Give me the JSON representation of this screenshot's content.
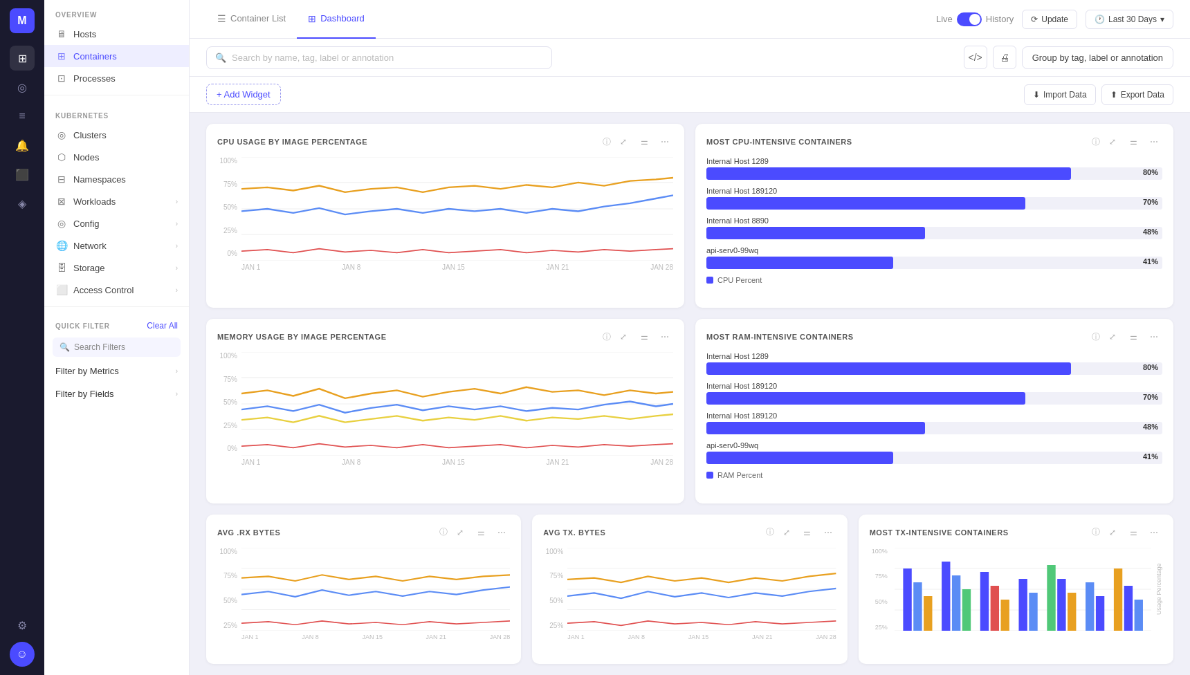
{
  "app": {
    "logo": "M",
    "logo_color": "#4b4bff"
  },
  "tabs": [
    {
      "id": "container-list",
      "label": "Container List",
      "icon": "☰",
      "active": false
    },
    {
      "id": "dashboard",
      "label": "Dashboard",
      "icon": "⊞",
      "active": true
    }
  ],
  "topbar": {
    "live_label": "Live",
    "history_label": "History",
    "update_label": "Update",
    "date_range": "Last 30 Days"
  },
  "toolbar": {
    "search_placeholder": "Search by name, tag, label or annotation",
    "group_by_label": "Group by tag, label or annotation",
    "code_icon": "</>",
    "printer_icon": "🖨"
  },
  "widget_toolbar": {
    "add_widget": "+ Add Widget",
    "import": "Import Data",
    "export": "Export Data"
  },
  "sidebar": {
    "overview_label": "OVERVIEW",
    "hosts_label": "Hosts",
    "containers_label": "Containers",
    "processes_label": "Processes",
    "kubernetes_label": "KUBERNETES",
    "clusters_label": "Clusters",
    "nodes_label": "Nodes",
    "namespaces_label": "Namespaces",
    "workloads_label": "Workloads",
    "config_label": "Config",
    "network_label": "Network",
    "storage_label": "Storage",
    "access_control_label": "Access Control",
    "quick_filter_label": "QUICK FILTER",
    "clear_all_label": "Clear All",
    "search_filters_placeholder": "Search Filters",
    "filter_metrics_label": "Filter by Metrics",
    "filter_fields_label": "Filter by Fields"
  },
  "cpu_chart": {
    "title": "CPU USAGE BY IMAGE PERCENTAGE",
    "y_labels": [
      "100%",
      "75%",
      "50%",
      "25%",
      "0%"
    ],
    "x_labels": [
      "JAN 1",
      "JAN 8",
      "JAN 15",
      "JAN 21",
      "JAN 28"
    ]
  },
  "cpu_intensive": {
    "title": "MOST CPU-INTENSIVE CONTAINERS",
    "bars": [
      {
        "label": "Internal Host 1289",
        "pct": 80
      },
      {
        "label": "Internal Host 189120",
        "pct": 70
      },
      {
        "label": "Internal Host 8890",
        "pct": 48
      },
      {
        "label": "api-serv0-99wq",
        "pct": 41
      }
    ],
    "legend": "CPU Percent"
  },
  "memory_chart": {
    "title": "MEMORY USAGE BY IMAGE PERCENTAGE",
    "y_labels": [
      "100%",
      "75%",
      "50%",
      "25%",
      "0%"
    ],
    "x_labels": [
      "JAN 1",
      "JAN 8",
      "JAN 15",
      "JAN 21",
      "JAN 28"
    ]
  },
  "ram_intensive": {
    "title": "MOST RAM-INTENSIVE CONTAINERS",
    "bars": [
      {
        "label": "Internal Host 1289",
        "pct": 80
      },
      {
        "label": "Internal Host 189120",
        "pct": 70
      },
      {
        "label": "Internal Host 189120",
        "pct": 48
      },
      {
        "label": "api-serv0-99wq",
        "pct": 41
      }
    ],
    "legend": "RAM Percent"
  },
  "rx_chart": {
    "title": "AVG .RX BYTES",
    "y_labels": [
      "100%",
      "75%",
      "50%",
      "25%"
    ],
    "x_labels": [
      "JAN 1",
      "JAN 8",
      "JAN 15",
      "JAN 21",
      "JAN 28"
    ]
  },
  "tx_chart": {
    "title": "AVG TX. BYTES",
    "y_labels": [
      "100%",
      "75%",
      "50%",
      "25%"
    ],
    "x_labels": [
      "JAN 1",
      "JAN 8",
      "JAN 15",
      "JAN 21",
      "JAN 28"
    ]
  },
  "tx_intensive": {
    "title": "MOST TX-INTENSIVE CONTAINERS",
    "y_label": "Usage Percentage",
    "y_labels": [
      "100%",
      "75%",
      "50%",
      "25%"
    ]
  },
  "rail_icons": [
    "⊞",
    "◎",
    "≡",
    "◈",
    "⟳",
    "◫",
    "⚙",
    "☺"
  ]
}
